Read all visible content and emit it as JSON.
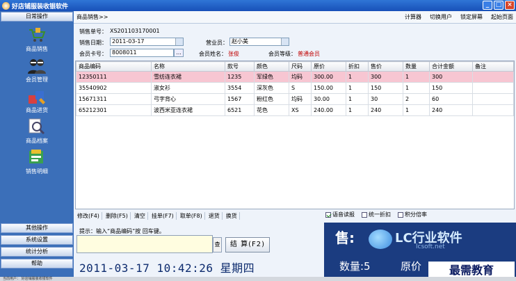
{
  "window": {
    "title": "好店铺服装收银软件",
    "buttons": [
      "_",
      "□",
      "×"
    ]
  },
  "sidebar": {
    "section_top": "日常操作",
    "items": [
      {
        "label": "商品销售",
        "icon": "cart-icon"
      },
      {
        "label": "会员管理",
        "icon": "members-icon"
      },
      {
        "label": "商品进货",
        "icon": "goods-in-icon"
      },
      {
        "label": "商品档案",
        "icon": "goods-archive-icon"
      },
      {
        "label": "销售明细",
        "icon": "sales-detail-icon"
      }
    ],
    "sections": [
      "其他操作",
      "系统设置",
      "统计分析",
      "帮助"
    ]
  },
  "topbar": {
    "breadcrumb": "商品销售>>",
    "actions": [
      "计算器",
      "切换用户",
      "锁定屏幕",
      "起始页面"
    ]
  },
  "form": {
    "order_no_label": "销售单号：",
    "order_no": "XS201103170001",
    "date_label": "销售日期：",
    "date": "2011-03-17",
    "clerk_label": "营业员：",
    "clerk": "赵小美",
    "card_label": "会员卡号：",
    "card": "8008011",
    "card_btn": "...",
    "member_name_label": "会员姓名：",
    "member_name": "张俊",
    "member_level_label": "会员等级：",
    "member_level": "普通会员"
  },
  "table": {
    "columns": [
      "商品编码",
      "名称",
      "款号",
      "颜色",
      "尺码",
      "原价",
      "折扣",
      "售价",
      "数量",
      "合计金额",
      "备注"
    ],
    "rows": [
      [
        "12350111",
        "雪纺连衣裙",
        "1235",
        "军绿色",
        "均码",
        "300.00",
        "1",
        "300",
        "1",
        "300",
        ""
      ],
      [
        "35540902",
        "淑女衫",
        "3554",
        "深灰色",
        "S",
        "150.00",
        "1",
        "150",
        "1",
        "150",
        ""
      ],
      [
        "15671311",
        "弓字背心",
        "1567",
        "粉红色",
        "均码",
        "30.00",
        "1",
        "30",
        "2",
        "60",
        ""
      ],
      [
        "65212301",
        "波西米亚连衣裙",
        "6521",
        "花色",
        "XS",
        "240.00",
        "1",
        "240",
        "1",
        "240",
        ""
      ]
    ]
  },
  "ops": [
    "修改(F4)",
    "删除(F5)",
    "清空",
    "挂单(F7)",
    "取单(F8)",
    "退货",
    "换货"
  ],
  "checks": [
    {
      "label": "语音读报",
      "checked": true
    },
    {
      "label": "统一折扣",
      "checked": false
    },
    {
      "label": "积分倍率",
      "checked": false
    }
  ],
  "hint": "提示：输入“商品编码”按 回车键。",
  "search_btn": "查",
  "settle_btn": "结 算(F2)",
  "clock": "2011-03-17 10:42:26 星期四",
  "display": {
    "sale": "售:",
    "brand": "LC行业软件",
    "sub": "lcsoft.net",
    "qty": "数量:5",
    "price": "原价",
    "watermark": "最需教育"
  },
  "status": "当前用户：  好店铺服装收银软件"
}
